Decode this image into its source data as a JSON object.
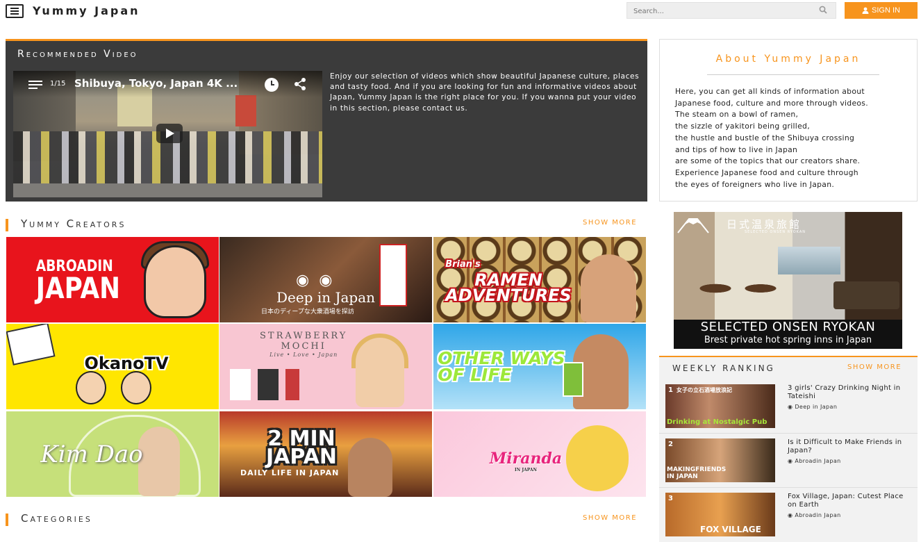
{
  "header": {
    "logo": "Yummy Japan",
    "search_placeholder": "Search...",
    "signin_label": "SIGN IN"
  },
  "recommended": {
    "title": "Recommended Video",
    "video": {
      "count": "1/15",
      "title": "Shibuya, Tokyo, Japan 4K ..."
    },
    "description": "Enjoy our selection of videos which show beautiful Japanese culture, places and tasty food. And if you are looking for fun and informative videos about Japan, Yummy Japan is the right place for you.  If you wanna put your video in this section, please contact us."
  },
  "creators": {
    "title": "Yummy Creators",
    "show_more": "SHOW MORE",
    "tiles": [
      {
        "line1": "ABROADIN",
        "line2": "JAPAN"
      },
      {
        "name": "Deep in Japan",
        "sub": "日本のディープな大衆酒場を探訪"
      },
      {
        "pre": "Brian's",
        "line1": "RAMEN",
        "line2": "ADVENTURES"
      },
      {
        "name": "OkanoTV"
      },
      {
        "line1": "STRAWBERRY",
        "line2": "MOCHI",
        "tagline": "Live • Love • Japan"
      },
      {
        "line1": "OTHER WAYS",
        "line2": "OF LIFE"
      },
      {
        "name": "Kim Dao"
      },
      {
        "line1": "2 MIN",
        "line2": "JAPAN",
        "sub": "DAILY LIFE IN JAPAN"
      },
      {
        "name": "Miranda",
        "sub": "IN JAPAN"
      }
    ]
  },
  "categories": {
    "title": "Categories",
    "show_more": "SHOW MORE"
  },
  "about": {
    "title": "About Yummy Japan",
    "lines": [
      "Here, you can get all kinds of information about",
      "Japanese food, culture and more through videos.",
      "The steam on a bowl of ramen,",
      "the sizzle of yakitori being grilled,",
      "the hustle and bustle of the Shibuya crossing",
      "and tips of how to live in Japan",
      "are some of the topics that our creators share.",
      "Experience Japanese food and culture through",
      "the eyes of foreigners who live in Japan."
    ]
  },
  "banner": {
    "jp_title": "日式温泉旅館",
    "jp_sub": "SELECTED ONSEN RYOKAN",
    "line1": "SELECTED ONSEN RYOKAN",
    "line2": "Brest private hot spring inns in Japan"
  },
  "ranking": {
    "title": "WEEKLY RANKING",
    "show_more": "SHOW MORE",
    "items": [
      {
        "rank": "1",
        "thumb_top": "女子の立石酒場放浪記",
        "thumb_caption": "Drinking at Nostalgic Pub",
        "title": "3 girls' Crazy Drinking Night in Tateishi",
        "author": "Deep in Japan"
      },
      {
        "rank": "2",
        "thumb_caption": "MAKINGFRIENDS IN JAPAN",
        "title": "Is it Difficult to Make Friends in Japan?",
        "author": "Abroadin Japan"
      },
      {
        "rank": "3",
        "thumb_caption": "FOX VILLAGE",
        "title": "Fox Village, Japan: Cutest Place on Earth",
        "author": "Abroadin Japan"
      }
    ]
  },
  "colors": {
    "accent": "#f7941d",
    "dark_panel": "#3b3b3b"
  }
}
